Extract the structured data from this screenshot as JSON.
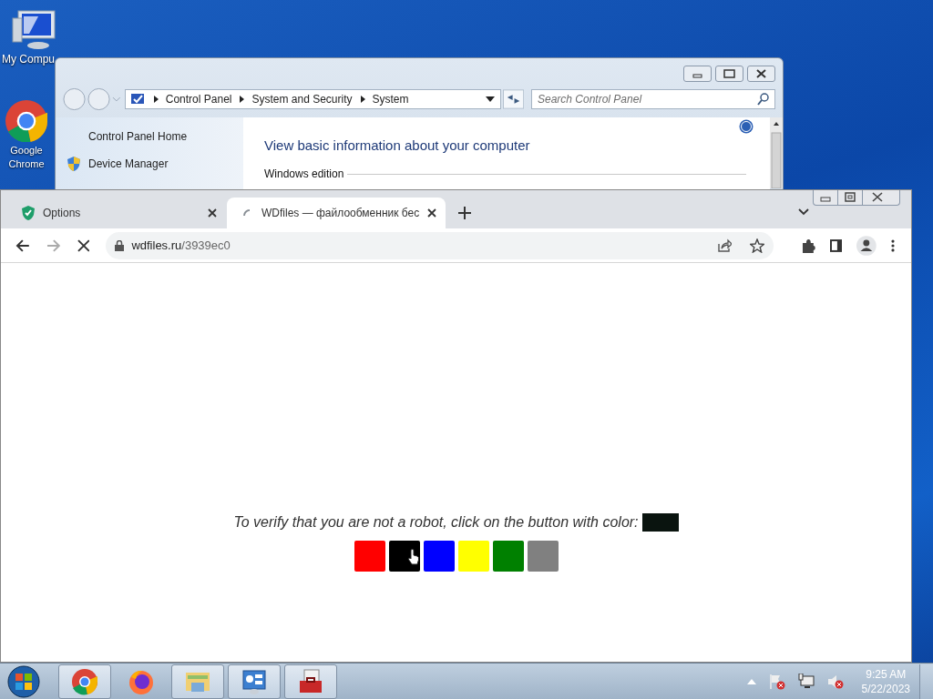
{
  "desktop_icons": [
    {
      "label": "My Compu",
      "kind": "computer"
    },
    {
      "label": "Google Chrome",
      "kind": "chrome"
    }
  ],
  "control_panel": {
    "breadcrumb": [
      "Control Panel",
      "System and Security",
      "System"
    ],
    "search": {
      "placeholder": "Search Control Panel"
    },
    "sidebar": [
      {
        "label": "Control Panel Home",
        "kind": "link"
      },
      {
        "label": "Device Manager",
        "kind": "shield"
      }
    ],
    "heading": "View basic information about your computer",
    "section": "Windows edition"
  },
  "browser": {
    "tabs": [
      {
        "title": "Options",
        "selected": false,
        "kind": "shield"
      },
      {
        "title": "WDfiles — файлообменник бес",
        "selected": true,
        "kind": "spinner"
      }
    ],
    "url": {
      "host": "wdfiles.ru",
      "path": "/3939ec0"
    },
    "page": {
      "prompt": "To verify that you are not a robot, click on the button with color:",
      "target": {
        "color": "#0a140f"
      },
      "color_buttons": [
        {
          "color": "#ff0000"
        },
        {
          "color": "#000000"
        },
        {
          "color": "#0000ff"
        },
        {
          "color": "#ffff00"
        },
        {
          "color": "#008000"
        },
        {
          "color": "#808080"
        }
      ]
    }
  },
  "taskbar": {
    "items": [
      {
        "kind": "chrome",
        "boxed": true
      },
      {
        "kind": "firefox",
        "boxed": false
      },
      {
        "kind": "folder",
        "boxed": true
      },
      {
        "kind": "control",
        "boxed": true
      },
      {
        "kind": "toolbox",
        "boxed": true
      }
    ],
    "clock": {
      "time": "9:25 AM",
      "date": "5/22/2023"
    }
  }
}
